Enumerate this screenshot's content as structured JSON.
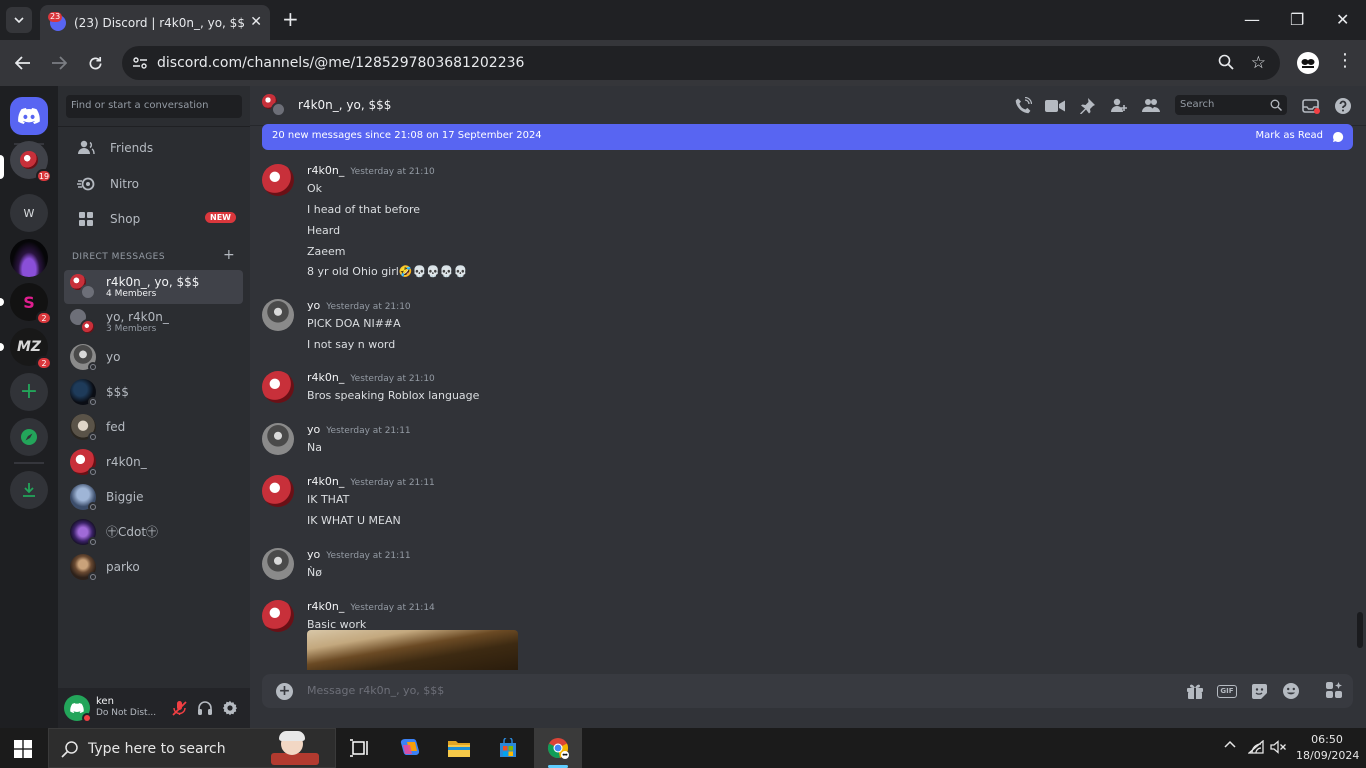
{
  "browser": {
    "tab_title": "(23) Discord | r4k0n_, yo, $$$",
    "tab_badge": "23",
    "url": "discord.com/channels/@me/1285297803681202236"
  },
  "guilds": [
    {
      "label": "",
      "badge": ""
    },
    {
      "label": "",
      "badge": "19"
    },
    {
      "label": "W",
      "badge": ""
    },
    {
      "label": "",
      "badge": ""
    },
    {
      "label": "",
      "badge": "2"
    },
    {
      "label": "",
      "badge": "2"
    }
  ],
  "sidebar": {
    "search_placeholder": "Find or start a conversation",
    "friends": "Friends",
    "nitro": "Nitro",
    "shop": "Shop",
    "shop_badge": "NEW",
    "dm_header": "DIRECT MESSAGES",
    "dms": [
      {
        "name": "r4k0n_, yo, $$$",
        "sub": "4 Members"
      },
      {
        "name": "yo, r4k0n_",
        "sub": "3 Members"
      },
      {
        "name": "yo",
        "sub": ""
      },
      {
        "name": "$$$",
        "sub": ""
      },
      {
        "name": "fed",
        "sub": ""
      },
      {
        "name": "r4k0n_",
        "sub": ""
      },
      {
        "name": "Biggie",
        "sub": ""
      },
      {
        "name": "㊉Cdot㊉",
        "sub": ""
      },
      {
        "name": "parko",
        "sub": ""
      }
    ]
  },
  "user": {
    "name": "ken",
    "status": "Do Not Dist..."
  },
  "chat": {
    "title": "r4k0n_, yo, $$$",
    "search_placeholder": "Search",
    "new_messages_bar": "20 new messages since 21:08 on 17 September 2024",
    "mark_as_read": "Mark as Read",
    "composer_placeholder": "Message r4k0n_, yo, $$$",
    "gif": "GIF",
    "messages": [
      {
        "author": "r4k0n_",
        "time": "Yesterday at 21:10",
        "lines": [
          "Ok",
          "I head of that before",
          "Heard",
          "Zaeem",
          "8 yr old Ohio girl🤣💀💀💀💀"
        ]
      },
      {
        "author": "yo",
        "time": "Yesterday at 21:10",
        "lines": [
          "PICK DOA NI##A",
          "I not say n word"
        ]
      },
      {
        "author": "r4k0n_",
        "time": "Yesterday at 21:10",
        "lines": [
          "Bros speaking Roblox language"
        ]
      },
      {
        "author": "yo",
        "time": "Yesterday at 21:11",
        "lines": [
          "Na"
        ]
      },
      {
        "author": "r4k0n_",
        "time": "Yesterday at 21:11",
        "lines": [
          "IK THAT",
          "IK WHAT U MEAN"
        ]
      },
      {
        "author": "yo",
        "time": "Yesterday at 21:11",
        "lines": [
          "Ǹø"
        ]
      },
      {
        "author": "r4k0n_",
        "time": "Yesterday at 21:14",
        "lines": [
          "Basic work"
        ]
      }
    ]
  },
  "taskbar": {
    "search_placeholder": "Type here to search",
    "time": "06:50",
    "date": "18/09/2024"
  },
  "colors": {
    "blurple": "#5865f2",
    "red": "#da373c",
    "green": "#23a55a"
  }
}
